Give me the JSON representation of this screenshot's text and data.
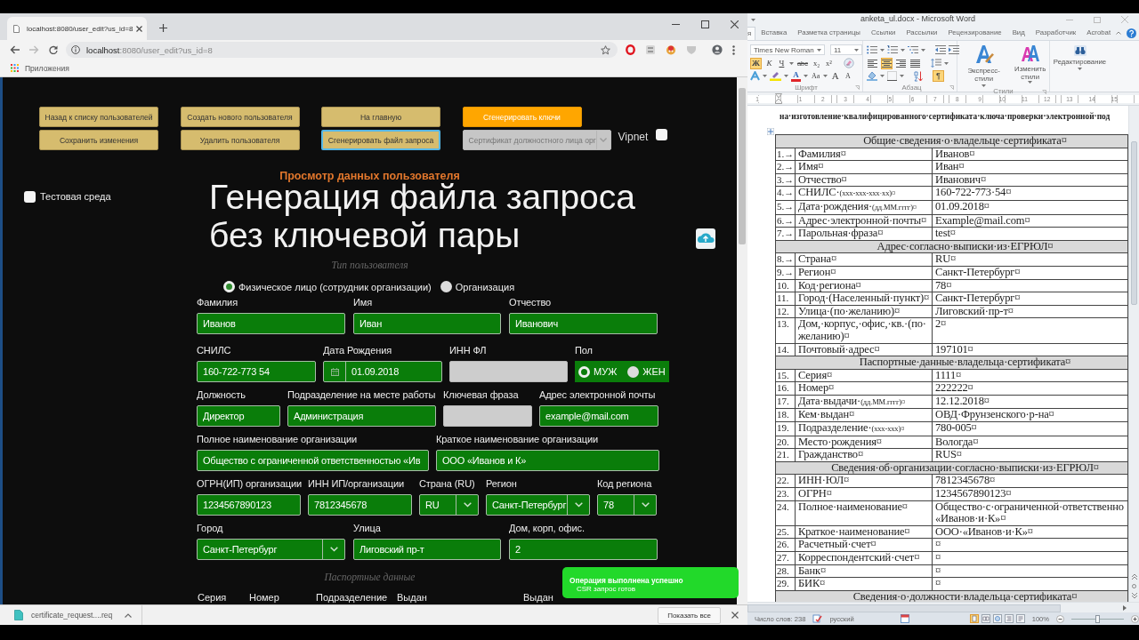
{
  "browser": {
    "tab": {
      "title": "localhost:8080/user_edit?us_id=8"
    },
    "address": {
      "host": "localhost",
      "path": ":8080/user_edit?us_id=8"
    },
    "bookmarks": [
      {
        "label": "Приложения"
      }
    ],
    "downloads": {
      "file": "certificate_request....req",
      "show_all": "Показать все"
    }
  },
  "page": {
    "buttons": [
      {
        "label": "Назад к списку пользователей",
        "kind": "button",
        "hovered": false,
        "focused": false,
        "disabled": false
      },
      {
        "label": "Создать нового пользователя",
        "kind": "button",
        "hovered": false,
        "focused": false,
        "disabled": false
      },
      {
        "label": "На главную",
        "kind": "button",
        "hovered": false,
        "focused": false,
        "disabled": false
      },
      {
        "label": "Сгенерировать ключи",
        "kind": "button",
        "hovered": true,
        "focused": false,
        "disabled": false
      },
      {
        "label": "Сохранить изменения",
        "kind": "button",
        "hovered": false,
        "focused": false,
        "disabled": false
      },
      {
        "label": "Удалить пользователя",
        "kind": "button",
        "hovered": false,
        "focused": false,
        "disabled": false
      },
      {
        "label": "Сгенерировать файл запроса",
        "kind": "button",
        "hovered": false,
        "focused": true,
        "disabled": false
      },
      {
        "label": "Сертификат должностного лица орг",
        "kind": "select",
        "hovered": false,
        "focused": false,
        "disabled": true
      }
    ],
    "vipnet": {
      "label": "Vipnet",
      "checked": false
    },
    "title": "Просмотр данных пользователя",
    "test_env": {
      "label": "Тестовая среда",
      "checked": false
    },
    "caption": [
      "Генерация файла запроса",
      "без ключевой пары"
    ],
    "user_type": {
      "legend": "Тип пользователя",
      "options": [
        {
          "label": "Физическое лицо (сотрудник организации)",
          "selected": true
        },
        {
          "label": "Организация",
          "selected": false
        }
      ]
    },
    "form_rows": [
      [
        {
          "label": "Фамилия",
          "kind": "text",
          "value": "Иванов",
          "disabled": false
        },
        {
          "label": "Имя",
          "kind": "text",
          "value": "Иван",
          "disabled": false
        },
        {
          "label": "Отчество",
          "kind": "text",
          "value": "Иванович",
          "disabled": false
        }
      ],
      [
        {
          "label": "СНИЛС",
          "kind": "text",
          "value": "160-722-773 54",
          "disabled": false
        },
        {
          "label": "Дата Рождения",
          "kind": "date",
          "value": "01.09.2018",
          "disabled": false
        },
        {
          "label": "ИНН ФЛ",
          "kind": "text",
          "disabled": true
        },
        {
          "label": "Пол",
          "kind": "radio",
          "disabled": false,
          "options": [
            {
              "label": "МУЖ",
              "selected": true
            },
            {
              "label": "ЖЕН",
              "selected": false
            }
          ]
        }
      ],
      [
        {
          "label": "Должность",
          "kind": "text",
          "value": "Директор",
          "disabled": false
        },
        {
          "label": "Подразделение на месте работы",
          "kind": "text",
          "value": "Администрация",
          "disabled": false
        },
        {
          "label": "Ключевая фраза",
          "kind": "text",
          "disabled": true
        },
        {
          "label": "Адрес электронной почты",
          "kind": "text",
          "value": "example@mail.com",
          "disabled": false
        }
      ],
      [
        {
          "label": "Полное наименование организации",
          "kind": "text",
          "value": "Общество с ограниченной ответственностью «Ив",
          "disabled": false
        },
        {
          "label": "Краткое наименование организации",
          "kind": "text",
          "value": "ООО «Иванов и К»",
          "disabled": false
        }
      ],
      [
        {
          "label": "ОГРН(ИП) организации",
          "kind": "text",
          "value": "1234567890123",
          "disabled": false
        },
        {
          "label": "ИНН ИП/организации",
          "kind": "text",
          "value": "7812345678",
          "disabled": false
        },
        {
          "label": "Страна (RU)",
          "kind": "select",
          "value": "RU",
          "disabled": false
        },
        {
          "label": "Регион",
          "kind": "select",
          "value": "Санкт-Петербург",
          "disabled": false
        },
        {
          "label": "Код региона",
          "kind": "select",
          "value": "78",
          "disabled": false
        }
      ],
      [
        {
          "label": "Город",
          "kind": "select",
          "value": "Санкт-Петербург",
          "disabled": false
        },
        {
          "label": "Улица",
          "kind": "text",
          "value": "Лиговский пр-т",
          "disabled": false
        },
        {
          "label": "Дом, корп, офис.",
          "kind": "text",
          "value": "2",
          "disabled": false
        }
      ]
    ],
    "passport": {
      "legend": "Паспортные данные",
      "columns": [
        "Серия",
        "Номер",
        "Подразделение",
        "Выдан",
        "Выдан"
      ]
    },
    "toast": {
      "title": "Операция выполнена успешно",
      "message": "CSR запрос готов"
    }
  },
  "word": {
    "title": "anketa_ul.docx - Microsoft Word",
    "tabs": [
      {
        "label": "я",
        "selected": true
      },
      {
        "label": "Вставка",
        "selected": false
      },
      {
        "label": "Разметка страницы",
        "selected": false
      },
      {
        "label": "Ссылки",
        "selected": false
      },
      {
        "label": "Рассылки",
        "selected": false
      },
      {
        "label": "Рецензирование",
        "selected": false
      },
      {
        "label": "Вид",
        "selected": false
      },
      {
        "label": "Разработчик",
        "selected": false
      },
      {
        "label": "Acrobat",
        "selected": false
      }
    ],
    "font": {
      "name": "Times New Roman",
      "size": "11",
      "group": "Шрифт",
      "styles": [
        {
          "label": "Ж",
          "kind": "bold",
          "on": true
        },
        {
          "label": "К",
          "kind": "italic",
          "on": false
        },
        {
          "label": "Ч",
          "kind": "underline",
          "on": false
        },
        {
          "label": "abc",
          "kind": "strike",
          "on": false
        },
        {
          "label": "x₂",
          "kind": "sub",
          "on": false
        },
        {
          "label": "x²",
          "kind": "sup",
          "on": false
        }
      ],
      "tools": [
        {
          "label": "A",
          "kind": "color"
        },
        {
          "label": "Aa",
          "kind": "case"
        },
        {
          "label": "A",
          "kind": "grow"
        },
        {
          "label": "A",
          "kind": "shrink"
        }
      ]
    },
    "paragraph": {
      "group": "Абзац",
      "alignments": [
        {
          "kind": "left",
          "selected": false
        },
        {
          "kind": "center",
          "selected": true
        },
        {
          "kind": "right",
          "selected": false
        },
        {
          "kind": "justify",
          "selected": false
        }
      ],
      "marks": {
        "label": "¶",
        "on": true
      }
    },
    "styles": {
      "group": "Стили",
      "quick": "Экспресс-стили",
      "change": "Изменить стили"
    },
    "editing": {
      "label": "Редактирование"
    },
    "ruler": [
      "1",
      "1",
      "2",
      "3",
      "4",
      "5",
      "6",
      "7",
      "8",
      "9",
      "10",
      "11",
      "12",
      "13",
      "14",
      "15"
    ],
    "document": {
      "heading": "на·изготовление·квалифицированного·сертификата·ключа·проверки·электронной·под",
      "sections": [
        {
          "title": "Общие·сведения·о·владельце·сертификата¤",
          "rows": [
            {
              "num": "1.→",
              "label": "Фамилия¤",
              "value": "Иванов¤"
            },
            {
              "num": "2.→",
              "label": "Имя¤",
              "value": "Иван¤"
            },
            {
              "num": "3.→",
              "label": "Отчество¤",
              "value": "Иванович¤"
            },
            {
              "num": "4.→",
              "label": "СНИЛС·",
              "note": "(xxx-xxx-xxx·xx)¤",
              "value": "160-722-773·54¤"
            },
            {
              "num": "5.→",
              "label": "Дата·рождения·",
              "note": "(дд.ММ.гггг)¤",
              "value": "01.09.2018¤"
            },
            {
              "num": "6.→",
              "label": "Адрес·электронной·почты¤",
              "value": "Example@mail.com¤"
            },
            {
              "num": "7.→",
              "label": "Парольная·фраза¤",
              "value": "test¤"
            }
          ]
        },
        {
          "title": "Адрес·согласно·выписки·из·ЕГРЮЛ¤",
          "rows": [
            {
              "num": "8.→",
              "label": "Страна¤",
              "value": "RU¤"
            },
            {
              "num": "9.→",
              "label": "Регион¤",
              "value": "Санкт-Петербург¤"
            },
            {
              "num": "10.",
              "label": "Код·региона¤",
              "value": "78¤"
            },
            {
              "num": "11.",
              "label": "Город·(Населенный·пункт)¤",
              "value": "Санкт-Петербург¤"
            },
            {
              "num": "12.",
              "label": "Улица·(по·желанию)¤",
              "value": "Лиговский·пр-т¤"
            },
            {
              "num": "13.",
              "label": "Дом,·корпус,·офис,·кв.·(по·\nжеланию)¤",
              "value": "2¤"
            },
            {
              "num": "14.",
              "label": "Почтовый·адрес¤",
              "value": "197101¤"
            }
          ]
        },
        {
          "title": "Паспортные·данные·владельца·сертификата¤",
          "rows": [
            {
              "num": "15.",
              "label": "Серия¤",
              "value": "1111¤"
            },
            {
              "num": "16.",
              "label": "Номер¤",
              "value": "222222¤"
            },
            {
              "num": "17.",
              "label": "Дата·выдачи·",
              "note": "(дд.ММ.гггг)¤",
              "value": "12.12.2018¤"
            },
            {
              "num": "18.",
              "label": "Кем·выдан¤",
              "value": "ОВД·Фрунзенского·р-на¤"
            },
            {
              "num": "19.",
              "label": "Подразделение·",
              "note": "(xxx-xxx)¤",
              "value": "780-005¤"
            },
            {
              "num": "20.",
              "label": "Место·рождения¤",
              "value": "Вологда¤"
            },
            {
              "num": "21.",
              "label": "Гражданство¤",
              "value": "RUS¤"
            }
          ]
        },
        {
          "title": "Сведения·об·организации·согласно·выписки·из·ЕГРЮЛ¤",
          "rows": [
            {
              "num": "22.",
              "label": "ИНН·ЮЛ¤",
              "value": "7812345678¤"
            },
            {
              "num": "23.",
              "label": "ОГРН¤",
              "value": "1234567890123¤"
            },
            {
              "num": "24.",
              "label": "Полное·наименование¤",
              "value": "Общество·с·ограниченной·ответственно\n«Иванов·и·К»¤"
            },
            {
              "num": "25.",
              "label": "Краткое·наименование¤",
              "value": "ООО·«Иванов·и·К»¤"
            },
            {
              "num": "26.",
              "label": "Расчетный·счет¤",
              "value": "¤"
            },
            {
              "num": "27.",
              "label": "Корреспондентский·счет¤",
              "value": "¤"
            },
            {
              "num": "28.",
              "label": "Банк¤",
              "value": "¤"
            },
            {
              "num": "29.",
              "label": "БИК¤",
              "value": "¤"
            }
          ]
        },
        {
          "title": "Сведения·о·должности·владельца·сертификата¤"
        }
      ]
    },
    "status": {
      "words": "Число слов: 238",
      "language": "русский",
      "views": [
        {
          "kind": "print",
          "selected": true
        },
        {
          "kind": "reading",
          "selected": false
        },
        {
          "kind": "web",
          "selected": false
        },
        {
          "kind": "outline",
          "selected": false
        },
        {
          "kind": "draft",
          "selected": false
        }
      ],
      "zoom": "100%",
      "zoom_slider": {
        "level": 0.5
      }
    }
  }
}
